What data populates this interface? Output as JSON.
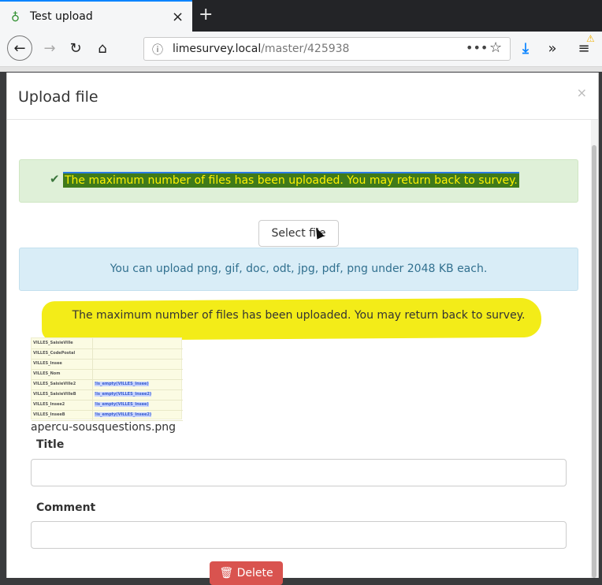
{
  "browser": {
    "tab_title": "Test upload",
    "tab_close": "×",
    "new_tab": "+",
    "url_host": "limesurvey.local",
    "url_path": "/master/425938",
    "url_more": "•••"
  },
  "modal": {
    "title": "Upload file",
    "close": "×",
    "success_message": "The maximum number of files has been uploaded. You may return back to survey.",
    "select_file_label": "Select file",
    "info_message": "You can upload png, gif, doc, odt, jpg, pdf, png under 2048 KB each.",
    "warning_message": "The maximum number of files has been uploaded. You may return back to survey.",
    "thumbnail_rows": [
      {
        "key": "VILLES_SaisieVille",
        "value": ""
      },
      {
        "key": "VILLES_CodePostal",
        "value": ""
      },
      {
        "key": "VILLES_Insee",
        "value": ""
      },
      {
        "key": "VILLES_Nom",
        "value": ""
      },
      {
        "key": "VILLES_SaisieVille2",
        "value": "!is_empty(VILLES_Insee)"
      },
      {
        "key": "VILLES_SaisieVilleB",
        "value": "!is_empty(VILLES_Insee2)"
      },
      {
        "key": "VILLES_Insee2",
        "value": "!is_empty(VILLES_Insee)"
      },
      {
        "key": "VILLES_InseeB",
        "value": "!is_empty(VILLES_Insee2)"
      }
    ],
    "filename": "apercu-sousquestions.png",
    "title_label": "Title",
    "title_value": "",
    "comment_label": "Comment",
    "comment_value": "",
    "delete_label": "Delete"
  },
  "colors": {
    "success_bg": "#dff0d8",
    "info_bg": "#d9edf7",
    "highlight_yellow": "#f3ec18",
    "danger": "#d9534f"
  }
}
